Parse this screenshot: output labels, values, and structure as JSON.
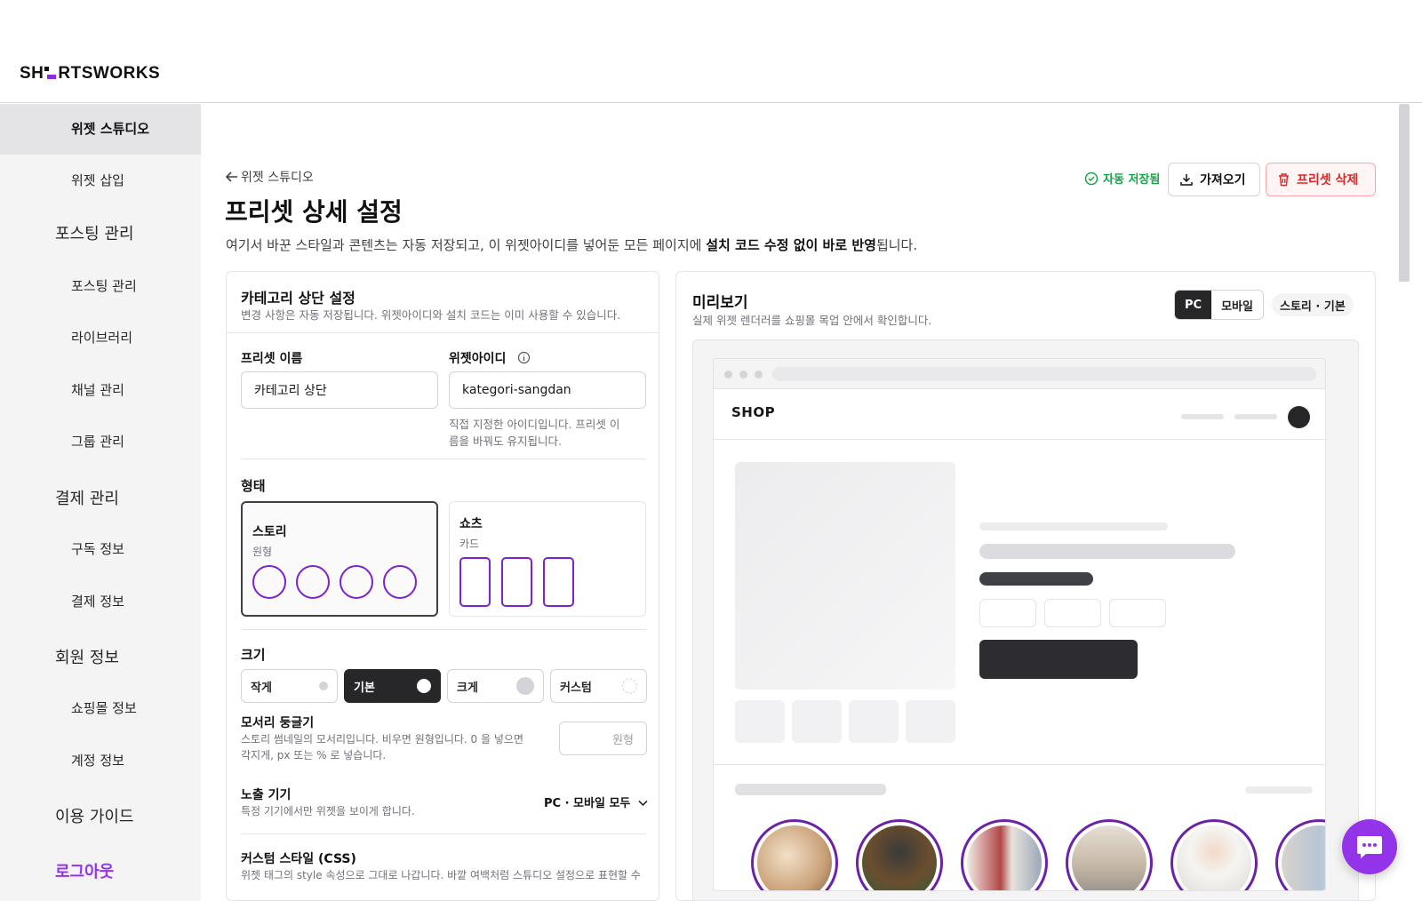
{
  "brand": {
    "logo_text_1": "SH",
    "logo_text_2": "RTSWORKS"
  },
  "sidebar": {
    "items": [
      {
        "label": "위젯 스튜디오"
      },
      {
        "label": "위젯 삽입"
      },
      {
        "label": "포스팅 관리"
      },
      {
        "label": "포스팅 관리"
      },
      {
        "label": "라이브러리"
      },
      {
        "label": "채널 관리"
      },
      {
        "label": "그룹 관리"
      },
      {
        "label": "결제 관리"
      },
      {
        "label": "구독 정보"
      },
      {
        "label": "결제 정보"
      },
      {
        "label": "회원 정보"
      },
      {
        "label": "쇼핑몰 정보"
      },
      {
        "label": "계정 정보"
      },
      {
        "label": "이용 가이드"
      },
      {
        "label": "로그아웃"
      }
    ]
  },
  "header": {
    "back_label": "위젯 스튜디오",
    "title": "프리셋 상세 설정",
    "desc_1": "여기서 바꾼 스타일과 콘텐츠는 자동 저장되고, 이 위젯아이디를 넣어둔 모든 페이지에 ",
    "desc_bold": "설치 코드 수정 없이 바로 반영",
    "desc_2": "됩니다.",
    "autosave": "자동 저장됨",
    "import_label": "가져오기",
    "delete_label": "프리셋 삭제"
  },
  "settings": {
    "title": "카테고리 상단 설정",
    "subtitle": "변경 사항은 자동 저장됩니다. 위젯아이디와 설치 코드는 이미 사용할 수 있습니다.",
    "preset_name_label": "프리셋 이름",
    "preset_name_value": "카테고리 상단",
    "widget_id_label": "위젯아이디",
    "widget_id_value": "kategori-sangdan",
    "widget_id_hint": "직접 지정한 아이디입니다. 프리셋 이름을 바꿔도 유지됩니다.",
    "form_label": "형태",
    "form_options": [
      {
        "title": "스토리",
        "sub": "원형"
      },
      {
        "title": "쇼츠",
        "sub": "카드"
      }
    ],
    "size_label": "크기",
    "size_options": [
      "작게",
      "기본",
      "크게",
      "커스텀"
    ],
    "radius_label": "모서리 둥글기",
    "radius_hint": "스토리 썸네일의 모서리입니다. 비우면 원형입니다. 0 을 넣으면 각지게, px 또는 % 로 넣습니다.",
    "radius_placeholder": "원형",
    "device_label": "노출 기기",
    "device_hint": "특정 기기에서만 위젯을 보이게 합니다.",
    "device_value": "PC · 모바일 모두",
    "css_label": "커스텀 스타일 (CSS)",
    "css_hint": "위젯 태그의 style 속성으로 그대로 나갑니다. 바깥 여백처럼 스튜디오 설정으로 표현할 수"
  },
  "preview": {
    "title": "미리보기",
    "subtitle": "실제 위젯 렌더러를 쇼핑몰 목업 안에서 확인합니다.",
    "seg": [
      "PC",
      "모바일"
    ],
    "pill": "스토리 · 기본",
    "shop_label": "SHOP"
  },
  "colors": {
    "accent": "#9333ea",
    "story_ring": "#6b21a8",
    "success": "#16a34a",
    "danger": "#dc2626"
  },
  "icons": [
    "arrow-left-icon",
    "check-circle-icon",
    "download-icon",
    "trash-icon",
    "info-icon",
    "chevron-down-icon",
    "chat-icon"
  ]
}
